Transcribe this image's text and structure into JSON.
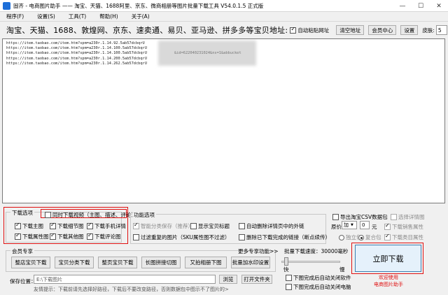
{
  "window": {
    "title": "固齐 - 电商图片助手 —— 淘宝、天猫、1688阿里、京东、微商相册等图片批量下载工具 V54.0.1.5 正式版",
    "minimize": "—",
    "maximize": "☐",
    "close": "✕"
  },
  "menu": [
    "程序(F)",
    "设置(S)",
    "工具(T)",
    "帮助(H)",
    "关于(A)"
  ],
  "address_bar": {
    "label": "淘宝、天猫、1688、敦煌网、京东、速卖通、易贝、亚马逊、拼多多等宝贝地址:",
    "auto_paste_label": "自动粘贴网址",
    "auto_paste_checked": true,
    "clear_button": "清空地址",
    "member_center_button": "会员中心",
    "settings_button": "设置",
    "skin_label": "皮肤:",
    "skin_value": "5"
  },
  "url_list": [
    "https://item.taobao.com/item.htm?spm=a230r.1.14.92.5ab57dcbqrU",
    "https://item.taobao.com/item.htm?spm=a230r.1.14.100.5ab57dcbqrU",
    "https://item.taobao.com/item.htm?spm=a230r.1.14.100.5ab57dcbqrU",
    "https://item.taobao.com/item.htm?spm=a230r.1.14.200.5ab57dcbqrU",
    "https://item.taobao.com/item.htm?spm=a230r.1.14.262.5ab57dcbqrU"
  ],
  "url_visible_fragment": "&id=622040231024&ns=1&abbucket",
  "download_options": {
    "title": "下载选项",
    "items": [
      {
        "label": "同时下载视频（主图、描述、评论）",
        "checked": false
      },
      {
        "label": "下载主图",
        "checked": true
      },
      {
        "label": "下载细节图",
        "checked": true
      },
      {
        "label": "下载手机详情",
        "checked": true
      },
      {
        "label": "下载属性图",
        "checked": true
      },
      {
        "label": "下载其他图",
        "checked": true
      },
      {
        "label": "下载评论图",
        "checked": true
      }
    ]
  },
  "function_options": {
    "title": "功能选项",
    "items": [
      {
        "label": "智能分类保存（推荐）",
        "checked": true,
        "disabled": true
      },
      {
        "label": "显示宝贝标题",
        "checked": false
      },
      {
        "label": "自动删除详情页中的外链",
        "checked": false
      },
      {
        "label": "过滤重复的图片（SKU属性图不过滤）",
        "checked": false
      },
      {
        "label": "删除已下载完成的链接（断点续传）",
        "checked": false
      }
    ]
  },
  "right_options": {
    "export_csv": "导出淘宝CSV数据包",
    "export_csv_checked": false,
    "pick_detail": "选择详情图",
    "price_label": "原价",
    "price_op": "加",
    "price_value": "0",
    "price_unit": "元",
    "sales_attr": "下载销售属性",
    "independent": "独立包",
    "composite": "复合包",
    "category_attr": "下载类目属性"
  },
  "member": {
    "title": "会员专享",
    "more": "更多专享功能>>",
    "buttons": [
      "整店宝贝下载",
      "宝贝分类下载",
      "整页宝贝下载",
      "长图拼接切图",
      "又拍相册下图",
      "批量加水印设置"
    ]
  },
  "speed": {
    "label": "批量下载速度：30000毫秒",
    "fast": "快",
    "slow": "慢",
    "level": 0.05
  },
  "after_download": [
    "下图完成后自动关闭软件",
    "下图完成后自动关闭电脑"
  ],
  "save": {
    "label": "保存位置：",
    "path": "E:\\下载图片",
    "browse_button": "浏览",
    "open_button": "打开文件夹",
    "tip": "友情提示：下载前请先选择好路径，下载后不要改变路径，否则数据包中图示不了图片的>"
  },
  "start": {
    "button": "立即下载",
    "welcome_line1": "欢迎使用",
    "welcome_line2": "电商图片助手"
  }
}
